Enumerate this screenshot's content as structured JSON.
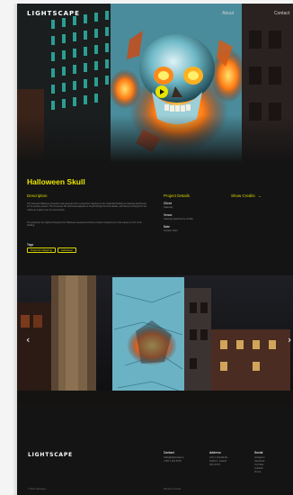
{
  "header": {
    "logo": "LIGHTSCAPE",
    "nav": [
      "About",
      "Contact"
    ]
  },
  "hero": {
    "play_label": "Play video"
  },
  "project": {
    "title": "Halloween Skull",
    "description_heading": "Description",
    "description_paragraphs": [
      "This haunted Halloween projection was developed for a projection mapping on the residential building at Gateway Apartments for the spooky season. The immersive 3D skull visual appears to break through the brick facade, with flames bursting from the cracks as it glows over the street below.",
      "The projection ran nightly throughout the Halloween weekend and drew crowds of passers-by to the square in front of the building."
    ],
    "details_heading": "Project Details",
    "credits_heading": "Show Credits",
    "details": [
      {
        "label": "Client",
        "value": "Gateway"
      },
      {
        "label": "Venue",
        "value": "Gateway Apartments, Dublin"
      },
      {
        "label": "Date",
        "value": "October 2021"
      }
    ],
    "tags_label": "Tags",
    "tags": [
      "Projection Mapping",
      "Halloween"
    ]
  },
  "gallery": {
    "prev": "‹",
    "next": "›"
  },
  "footer": {
    "logo": "LIGHTSCAPE",
    "contact_heading": "Contact",
    "contact_lines": [
      "hello@lightscape.ie",
      "+353 1 234 5678"
    ],
    "address_heading": "Address",
    "address_lines": [
      "Unit 4, Docklands",
      "Dublin 1, Ireland",
      "D01 X2Y3"
    ],
    "social_heading": "Social",
    "social_lines": [
      "Instagram",
      "Facebook",
      "YouTube",
      "LinkedIn",
      "Vimeo"
    ],
    "copyright": "© 2021 Lightscape",
    "credit": "Website by Studio"
  },
  "colors": {
    "accent": "#e8e400",
    "background": "#141414"
  }
}
